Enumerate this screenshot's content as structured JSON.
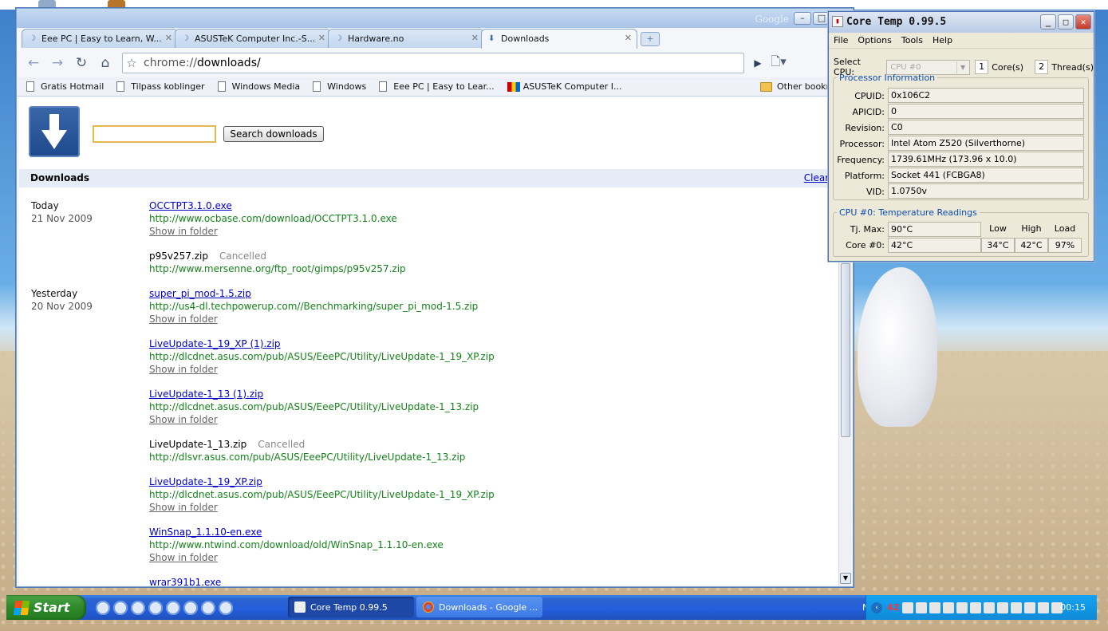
{
  "chrome": {
    "google_label": "Google",
    "tabs": [
      {
        "label": "Eee PC | Easy to Learn, W..."
      },
      {
        "label": "ASUSTeK Computer Inc.-S..."
      },
      {
        "label": "Hardware.no"
      },
      {
        "label": "Downloads"
      }
    ],
    "url_prefix": "chrome://",
    "url_path": "downloads/",
    "bookmarks": [
      "Gratis Hotmail",
      "Tilpass koblinger",
      "Windows Media",
      "Windows",
      "Eee PC | Easy to Lear...",
      "ASUSTeK Computer I...",
      "Other bookm"
    ],
    "search_button": "Search downloads",
    "section_title": "Downloads",
    "clear_all": "Clear all",
    "groups": [
      {
        "day": "Today",
        "date": "21 Nov 2009"
      },
      {
        "day": "Yesterday",
        "date": "20 Nov 2009"
      }
    ],
    "items": [
      {
        "name": "OCCTPT3.1.0.exe",
        "url": "http://www.ocbase.com/download/OCCTPT3.1.0.exe",
        "show": "Show in folder",
        "status": ""
      },
      {
        "name": "p95v257.zip",
        "url": "http://www.mersenne.org/ftp_root/gimps/p95v257.zip",
        "show": "",
        "status": "Cancelled"
      },
      {
        "name": "super_pi_mod-1.5.zip",
        "url": "http://us4-dl.techpowerup.com//Benchmarking/super_pi_mod-1.5.zip",
        "show": "Show in folder",
        "status": ""
      },
      {
        "name": "LiveUpdate-1_19_XP (1).zip",
        "url": "http://dlcdnet.asus.com/pub/ASUS/EeePC/Utility/LiveUpdate-1_19_XP.zip",
        "show": "Show in folder",
        "status": ""
      },
      {
        "name": "LiveUpdate-1_13 (1).zip",
        "url": "http://dlcdnet.asus.com/pub/ASUS/EeePC/Utility/LiveUpdate-1_13.zip",
        "show": "Show in folder",
        "status": ""
      },
      {
        "name": "LiveUpdate-1_13.zip",
        "url": "http://dlsvr.asus.com/pub/ASUS/EeePC/Utility/LiveUpdate-1_13.zip",
        "show": "",
        "status": "Cancelled"
      },
      {
        "name": "LiveUpdate-1_19_XP.zip",
        "url": "http://dlcdnet.asus.com/pub/ASUS/EeePC/Utility/LiveUpdate-1_19_XP.zip",
        "show": "Show in folder",
        "status": ""
      },
      {
        "name": "WinSnap_1.1.10-en.exe",
        "url": "http://www.ntwind.com/download/old/WinSnap_1.1.10-en.exe",
        "show": "Show in folder",
        "status": ""
      },
      {
        "name": "wrar391b1.exe",
        "url": "",
        "show": "",
        "status": ""
      }
    ]
  },
  "coretemp": {
    "title": "Core Temp 0.99.5",
    "menu": [
      "File",
      "Options",
      "Tools",
      "Help"
    ],
    "select_cpu_label": "Select CPU:",
    "cpu_value": "CPU #0",
    "cores": "1",
    "cores_label": "Core(s)",
    "threads": "2",
    "threads_label": "Thread(s)",
    "proc_info_title": "Processor Information",
    "proc_rows": [
      {
        "label": "CPUID:",
        "value": "0x106C2"
      },
      {
        "label": "APICID:",
        "value": "0"
      },
      {
        "label": "Revision:",
        "value": "C0"
      },
      {
        "label": "Processor:",
        "value": "Intel Atom Z520 (Silverthorne)"
      },
      {
        "label": "Frequency:",
        "value": "1739.61MHz (173.96 x 10.0)"
      },
      {
        "label": "Platform:",
        "value": "Socket 441 (FCBGA8)"
      },
      {
        "label": "VID:",
        "value": "1.0750v"
      }
    ],
    "temp_title": "CPU #0: Temperature Readings",
    "tjmax_label": "Tj. Max:",
    "tjmax": "90°C",
    "col_low": "Low",
    "col_high": "High",
    "col_load": "Load",
    "core0_label": "Core #0:",
    "core0": "42°C",
    "low": "34°C",
    "high": "42°C",
    "load": "97%"
  },
  "taskbar": {
    "start": "Start",
    "items": [
      "Core Temp 0.99.5",
      "Downloads - Google ..."
    ],
    "lang": "NO",
    "tray_temp": "42",
    "clock": "00:15"
  }
}
